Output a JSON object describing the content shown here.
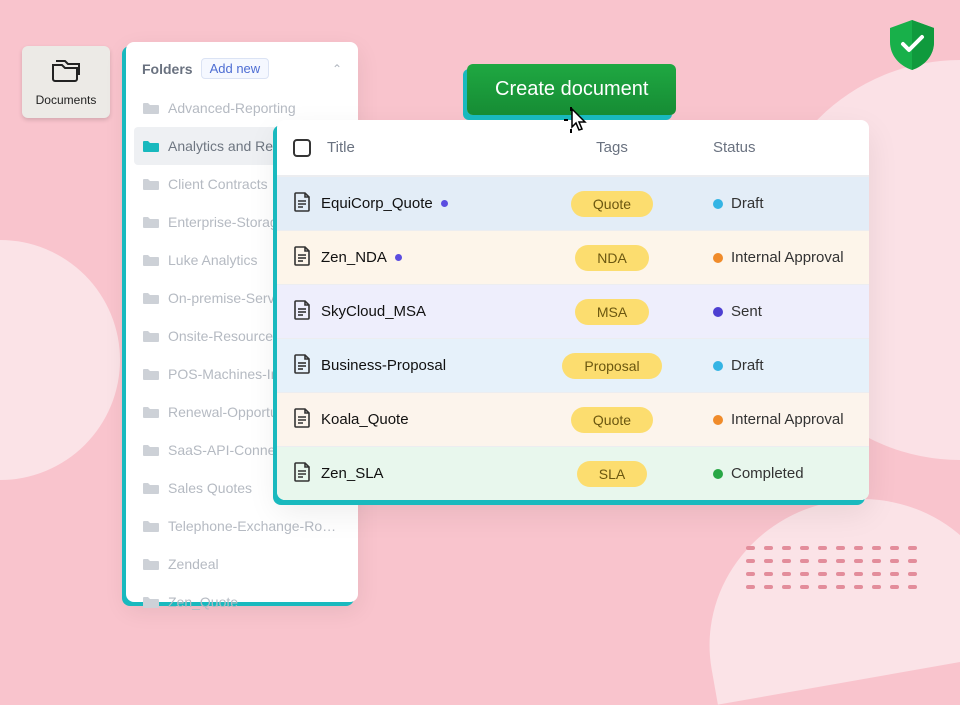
{
  "tile": {
    "label": "Documents"
  },
  "sidebar": {
    "title": "Folders",
    "add_new": "Add new",
    "items": [
      {
        "label": "Advanced-Reporting",
        "active": false
      },
      {
        "label": "Analytics and Reporting",
        "active": true
      },
      {
        "label": "Client Contracts",
        "active": false
      },
      {
        "label": "Enterprise-Storage-Packages",
        "active": false
      },
      {
        "label": "Luke Analytics",
        "active": false
      },
      {
        "label": "On-premise-Server-Installation",
        "active": false
      },
      {
        "label": "Onsite-Resource-Deployment",
        "active": false
      },
      {
        "label": "POS-Machines-Installation",
        "active": false
      },
      {
        "label": "Renewal-Opportunities",
        "active": false
      },
      {
        "label": "SaaS-API-Connections",
        "active": false
      },
      {
        "label": "Sales Quotes",
        "active": false
      },
      {
        "label": "Telephone-Exchange-Rout...",
        "active": false
      },
      {
        "label": "Zendeal",
        "active": false
      },
      {
        "label": "Zen_Quote",
        "active": false
      }
    ]
  },
  "create_button": "Create document",
  "table": {
    "headers": {
      "title": "Title",
      "tags": "Tags",
      "status": "Status"
    },
    "rows": [
      {
        "title": "EquiCorp_Quote",
        "marker": true,
        "tag": "Quote",
        "status": "Draft",
        "status_color": "#34b4e4"
      },
      {
        "title": "Zen_NDA",
        "marker": true,
        "tag": "NDA",
        "status": "Internal Approval",
        "status_color": "#f08b2a"
      },
      {
        "title": "SkyCloud_MSA",
        "marker": false,
        "tag": "MSA",
        "status": "Sent",
        "status_color": "#4d3fd1"
      },
      {
        "title": "Business-Proposal",
        "marker": false,
        "tag": "Proposal",
        "status": "Draft",
        "status_color": "#34b4e4"
      },
      {
        "title": "Koala_Quote",
        "marker": false,
        "tag": "Quote",
        "status": "Internal Approval",
        "status_color": "#f08b2a"
      },
      {
        "title": "Zen_SLA",
        "marker": false,
        "tag": "SLA",
        "status": "Completed",
        "status_color": "#28a745"
      }
    ]
  }
}
